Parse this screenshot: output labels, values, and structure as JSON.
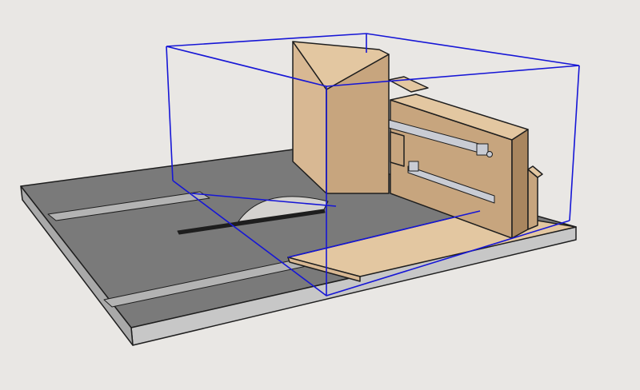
{
  "app": {
    "type": "3d-model-viewport",
    "background": "#e9e7e4"
  },
  "model": {
    "subject": "table-saw-sled-with-sliding-fence",
    "components": [
      "saw-table-top",
      "miter-slot-left",
      "miter-slot-right",
      "saw-blade",
      "blade-slot",
      "sled-base-board",
      "vertical-fence-board",
      "carriage-housing",
      "top-rail",
      "slide-bars",
      "support-blocks",
      "selection-bounding-box"
    ]
  },
  "colors": {
    "table_top": "#7a7a7a",
    "table_edge": "#a9a9a9",
    "table_side": "#c7c7c7",
    "slot": "#b3b3b3",
    "blade": "#d4d2cf",
    "wood_face": "#c7a57e",
    "wood_light": "#e3c7a1",
    "wood_dark": "#a9865f",
    "wood_side": "#d8b893",
    "rail_metal": "#c9ccd4",
    "outline": "#1e1e1e",
    "selection": "#1616d6"
  }
}
